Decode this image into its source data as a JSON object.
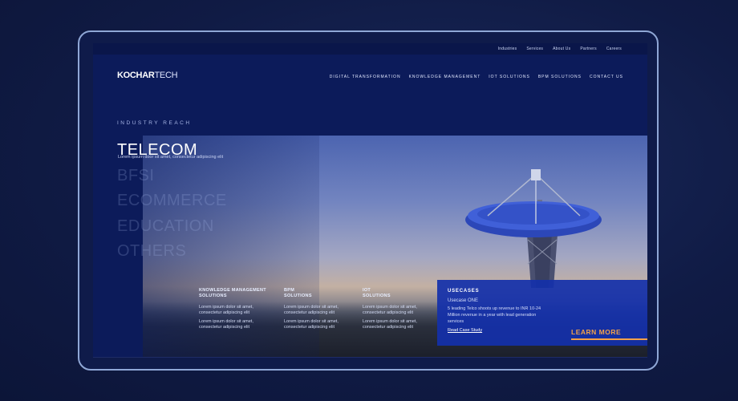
{
  "topbar": {
    "links": [
      "Industries",
      "Services",
      "About Us",
      "Partners",
      "Careers"
    ]
  },
  "logo": {
    "bold": "KOCHAR",
    "light": "TECH"
  },
  "nav": {
    "items": [
      "DIGITAL TRANSFORMATION",
      "KNOWLEDGE MANAGEMENT",
      "IOT SOLUTIONS",
      "BPM SOLUTIONS",
      "CONTACT US"
    ]
  },
  "section": {
    "label": "INDUSTRY REACH"
  },
  "industries": {
    "active": "TELECOM",
    "description": "Lorem ipsum door sit amet, consectetur adipiscing elit",
    "others": [
      "BFSI",
      "ECOMMERCE",
      "EDUCATION",
      "OTHERS"
    ]
  },
  "solutions": [
    {
      "title": "KNOWLEDGE MANAGEMENT SOLUTIONS",
      "text1": "Lorem ipsum dolor sit amet, consectetur adipiscing elit",
      "text2": "Lorem ipsum dolor sit amet, consectetur adipiscing elit"
    },
    {
      "title": "BPM SOLUTIONS",
      "text1": "Lorem ipsum dolor sit amet, consectetur adipiscing elit",
      "text2": "Lorem ipsum dolor sit amet, consectetur adipiscing elit"
    },
    {
      "title": "IOT SOLUTIONS",
      "text1": "Lorem ipsum dolor sit amet, consectetur adipiscing elit",
      "text2": "Lorem ipsum dolor sit amet, consectetur adipiscing elit"
    }
  ],
  "usecase": {
    "title": "USECASES",
    "subtitle": "Usecase ONE",
    "text": "5 leading Telco shoots up revenue to INR 10-24 Million revenue in a year with lead generation services",
    "link": "Read Case Study",
    "cta": "LEARN MORE"
  },
  "colors": {
    "accent": "#f2a14a",
    "panel": "#1430aa",
    "background": "#0c1b5a"
  }
}
